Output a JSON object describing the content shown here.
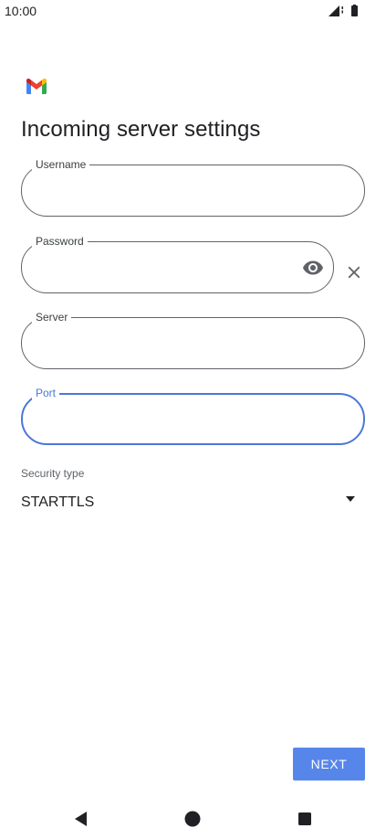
{
  "status_bar": {
    "time": "10:00",
    "icons": [
      "signal-icon",
      "battery-icon"
    ]
  },
  "app": {
    "logo": "gmail-logo"
  },
  "page": {
    "title": "Incoming server settings"
  },
  "form": {
    "username": {
      "label": "Username",
      "value": ""
    },
    "password": {
      "label": "Password",
      "value": "",
      "visibility_icon": "eye-icon",
      "clear_icon": "close-icon"
    },
    "server": {
      "label": "Server",
      "value": ""
    },
    "port": {
      "label": "Port",
      "value": "",
      "focused": true,
      "focus_color": "#4a78d8"
    },
    "security_type": {
      "label": "Security type",
      "selected": "STARTTLS",
      "icon": "dropdown-arrow-icon"
    }
  },
  "actions": {
    "next_label": "NEXT",
    "next_color": "#5786ea"
  },
  "navigation": {
    "back": "back-icon",
    "home": "home-icon",
    "recents": "recents-icon"
  }
}
